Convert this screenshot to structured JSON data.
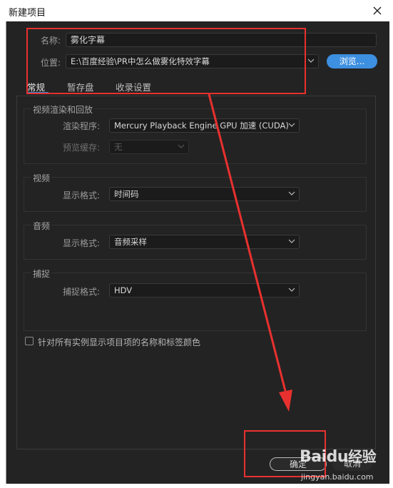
{
  "window": {
    "title": "新建项目",
    "close_icon": "close-icon"
  },
  "name_row": {
    "label": "名称:",
    "value": "雾化字幕"
  },
  "location_row": {
    "label": "位置:",
    "value": "E:\\百度经验\\PR中怎么做雾化特效字幕",
    "browse_label": "浏览..."
  },
  "tabs": [
    {
      "label": "常规",
      "active": true
    },
    {
      "label": "暂存盘",
      "active": false
    },
    {
      "label": "收录设置",
      "active": false
    }
  ],
  "render_group": {
    "title": "视频渲染和回放",
    "renderer_label": "渲染程序:",
    "renderer_value": "Mercury Playback Engine GPU 加速 (CUDA)",
    "preview_cache_label": "预览缓存:",
    "preview_cache_value": "无"
  },
  "video_group": {
    "title": "视频",
    "format_label": "显示格式:",
    "format_value": "时间码"
  },
  "audio_group": {
    "title": "音频",
    "format_label": "显示格式:",
    "format_value": "音频采样"
  },
  "capture_group": {
    "title": "捕捉",
    "format_label": "捕捉格式:",
    "format_value": "HDV"
  },
  "checkbox": {
    "label": "针对所有实例显示项目项的名称和标签颜色",
    "checked": false
  },
  "footer": {
    "ok_label": "确定",
    "cancel_label": "取消"
  },
  "watermark": {
    "logo": "Baidu经验",
    "url": "jingyan.baidu.com"
  },
  "colors": {
    "accent": "#3d8fe0",
    "annotation": "#e8312f",
    "dialog_bg": "#232323"
  }
}
